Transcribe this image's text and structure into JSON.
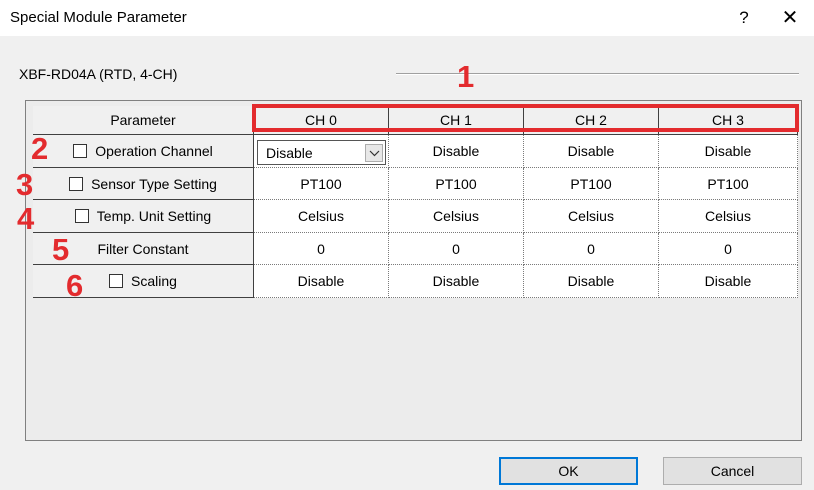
{
  "window": {
    "title": "Special Module Parameter",
    "help_glyph": "?",
    "close_glyph": "✕"
  },
  "module_label": "XBF-RD04A (RTD, 4-CH)",
  "table": {
    "header": {
      "parameter": "Parameter",
      "channels": [
        "CH 0",
        "CH 1",
        "CH 2",
        "CH 3"
      ]
    },
    "rows": [
      {
        "label": "Operation Channel",
        "checkbox": true,
        "checked": false,
        "values": [
          "Disable",
          "Disable",
          "Disable",
          "Disable"
        ]
      },
      {
        "label": "Sensor Type Setting",
        "checkbox": true,
        "checked": false,
        "values": [
          "PT100",
          "PT100",
          "PT100",
          "PT100"
        ]
      },
      {
        "label": "Temp. Unit Setting",
        "checkbox": true,
        "checked": false,
        "values": [
          "Celsius",
          "Celsius",
          "Celsius",
          "Celsius"
        ]
      },
      {
        "label": "Filter Constant",
        "checkbox": false,
        "checked": false,
        "values": [
          "0",
          "0",
          "0",
          "0"
        ]
      },
      {
        "label": "Scaling",
        "checkbox": true,
        "checked": false,
        "values": [
          "Disable",
          "Disable",
          "Disable",
          "Disable"
        ]
      }
    ],
    "active_combo": {
      "row": 0,
      "col": 0,
      "value": "Disable"
    }
  },
  "annotations": {
    "marker_color": "#e32b2e",
    "numbers": [
      "1",
      "2",
      "3",
      "4",
      "5",
      "6"
    ]
  },
  "buttons": {
    "ok": "OK",
    "cancel": "Cancel"
  }
}
